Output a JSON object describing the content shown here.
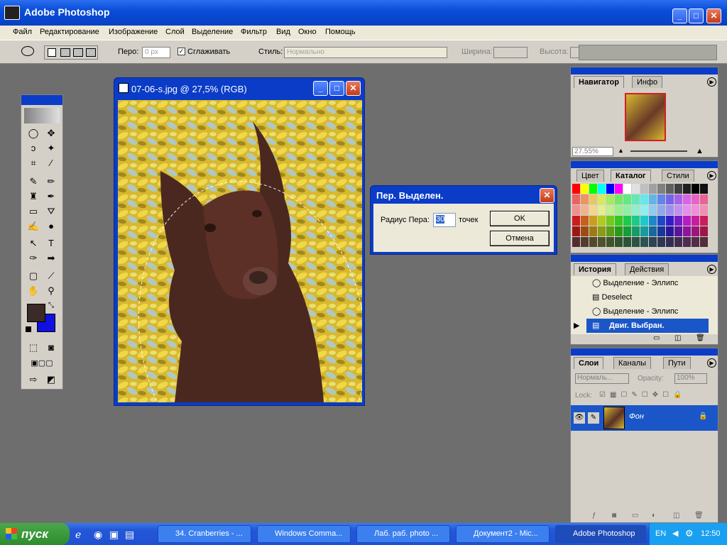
{
  "app": {
    "title": "Adobe Photoshop"
  },
  "menu": [
    "Файл",
    "Редактирование",
    "Изображение",
    "Слой",
    "Выделение",
    "Фильтр",
    "Вид",
    "Окно",
    "Помощь"
  ],
  "options": {
    "feather_label": "Перо:",
    "feather_value": "0 px",
    "antialias_label": "Сглаживать",
    "style_label": "Стиль:",
    "style_value": "Нормально",
    "width_label": "Ширина:",
    "height_label": "Высота:"
  },
  "document": {
    "title": "07-06-s.jpg @ 27,5% (RGB)"
  },
  "dialog": {
    "title": "Пер. Выделен.",
    "radius_label": "Радиус Пера:",
    "radius_value": "30",
    "unit": "точек",
    "ok": "OK",
    "cancel": "Отмена"
  },
  "navigator": {
    "tabs": [
      "Навигатор",
      "Инфо"
    ],
    "zoom": "27.55%"
  },
  "swatches": {
    "tabs": [
      "Цвет",
      "Каталог",
      "Стили"
    ]
  },
  "history": {
    "tabs": [
      "История",
      "Действия"
    ],
    "items": [
      "Выделение - Эллипс",
      "Deselect",
      "Выделение - Эллипс",
      "Двиг. Выбран."
    ]
  },
  "layers": {
    "tabs": [
      "Слои",
      "Каналы",
      "Пути"
    ],
    "blend": "Нормаль...",
    "opacity_label": "Opacity:",
    "opacity_value": "100%",
    "lock_label": "Lock:",
    "layer_name": "Фон"
  },
  "taskbar": {
    "start": "пуск",
    "tasks": [
      "34. Cranberries - ...",
      "Windows Comma...",
      "Лаб. раб. photo ...",
      "Документ2 - Mic...",
      "Adobe Photoshop"
    ],
    "lang": "EN",
    "time": "12:50"
  },
  "colors": {
    "xp_blue": "#0a3cc8",
    "foreground": "#3a2a28",
    "background": "#1010e0"
  }
}
